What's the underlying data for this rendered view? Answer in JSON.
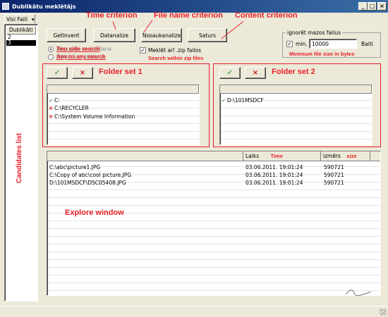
{
  "window": {
    "title": "Dublikātu meklētājs"
  },
  "left_panel": {
    "tab_label": "Visi Faili",
    "list_header": "Dublikāti",
    "items": [
      "2",
      "3"
    ],
    "selected_index": 1,
    "annotation": "Candidates list"
  },
  "toolbar": {
    "buttons": [
      "GetInvent",
      "Datanalize",
      "Nosaukanalize",
      "Saturs"
    ]
  },
  "annotations": {
    "time_criterion": "Time criterion",
    "file_name_criterion": "File name criterion",
    "content_criterion": "Content criterion",
    "two_side_search": "Two side search",
    "any_to_any_search": "Any-to-any search",
    "search_zip": "Search within zip files",
    "min_size": "Minimum file size in bytes",
    "folder_set_1": "Folder set 1",
    "folder_set_2": "Folder set 2",
    "time_col": "Time",
    "size_col": "size",
    "explore_window": "Explore window"
  },
  "options": {
    "radio1_label": "Abpusēja meklēšana",
    "radio2_label": "Jebkurš ar jebkuru",
    "zip_checkbox_label": "Meklēt arī .zip failos",
    "zip_checked": true
  },
  "ignore_small": {
    "group_title": "ignorēt mazos failus",
    "min_label": "min.",
    "min_checked": true,
    "value": "10000",
    "unit": "Baiti"
  },
  "folder_set_1": {
    "add_icon": "check-icon",
    "remove_icon": "cross-icon",
    "folders": [
      {
        "status": "include",
        "path": "C:"
      },
      {
        "status": "exclude",
        "path": "C:\\RECYCLER"
      },
      {
        "status": "exclude",
        "path": "C:\\System Volume Information"
      }
    ]
  },
  "folder_set_2": {
    "add_icon": "check-icon",
    "remove_icon": "cross-icon",
    "folders": [
      {
        "status": "include",
        "path": "D:\\101MSDCF"
      }
    ]
  },
  "explore": {
    "columns": [
      "",
      "Laiks",
      "izmērs"
    ],
    "rows": [
      {
        "path": "C:\\abc\\picture1.JPG",
        "time": "03.06.2011. 19:01:24",
        "size": "590721"
      },
      {
        "path": "C:\\Copy of abc\\cool picture.JPG",
        "time": "03.06.2011. 19:01:24",
        "size": "590721"
      },
      {
        "path": "D:\\101MSDCF\\DSC05408.JPG",
        "time": "03.06.2011. 19:01:24",
        "size": "590721"
      }
    ]
  },
  "colors": {
    "annotation": "#e8202a",
    "include": "#1a8a1a",
    "exclude": "#d01515",
    "titlebar": "#0a246a"
  }
}
